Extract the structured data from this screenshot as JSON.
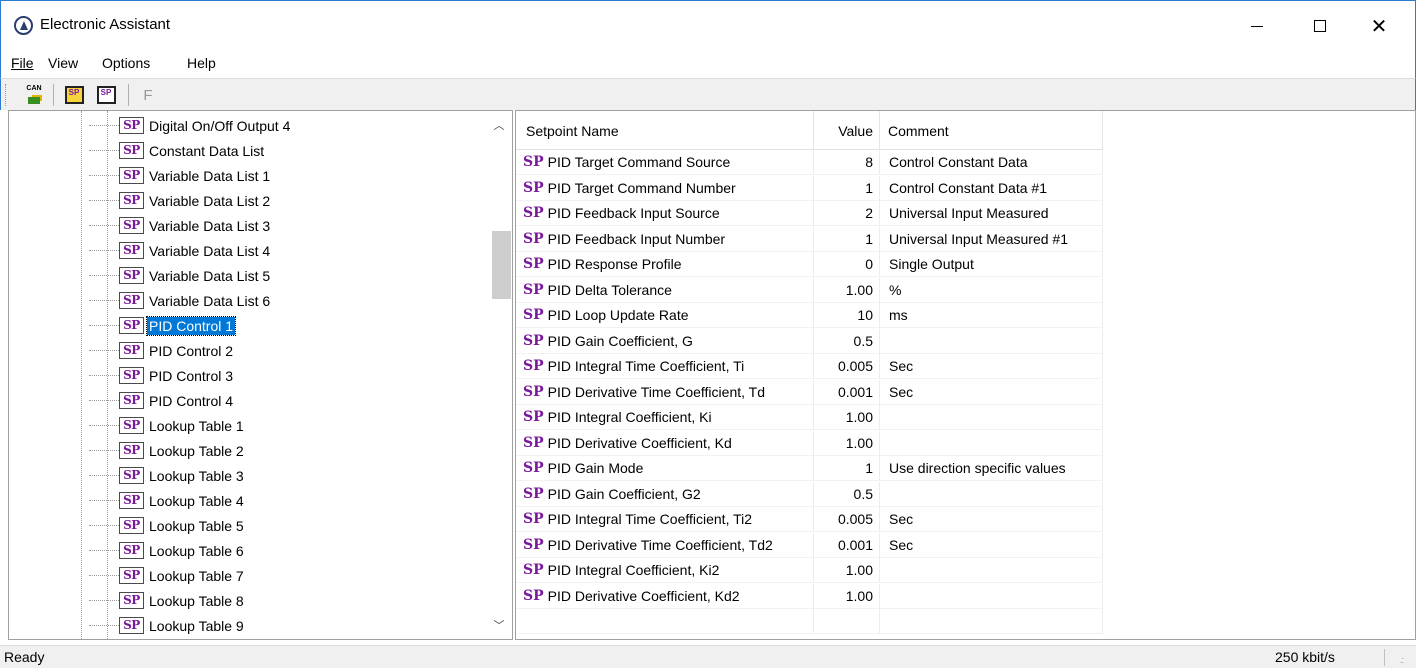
{
  "window": {
    "title": "Electronic Assistant"
  },
  "menu": {
    "file": "File",
    "view": "View",
    "options": "Options",
    "help": "Help"
  },
  "toolbar": {
    "can_icon_text": "CAN",
    "sp_open_text": "SP",
    "sp_save_text": "SP",
    "f_label": "F"
  },
  "tree": {
    "icon_text": "SP",
    "items": [
      "Digital On/Off Output 4",
      "Constant Data List",
      "Variable Data List 1",
      "Variable Data List 2",
      "Variable Data List 3",
      "Variable Data List 4",
      "Variable Data List 5",
      "Variable Data List 6",
      "PID Control 1",
      "PID Control 2",
      "PID Control 3",
      "PID Control 4",
      "Lookup Table 1",
      "Lookup Table 2",
      "Lookup Table 3",
      "Lookup Table 4",
      "Lookup Table 5",
      "Lookup Table 6",
      "Lookup Table 7",
      "Lookup Table 8",
      "Lookup Table 9"
    ],
    "selected": "PID Control 1"
  },
  "grid": {
    "columns": {
      "name": "Setpoint Name",
      "value": "Value",
      "comment": "Comment"
    },
    "sp_tag": "SP",
    "rows": [
      {
        "name": "PID Target Command Source",
        "value": "8",
        "comment": "Control Constant Data"
      },
      {
        "name": "PID Target Command Number",
        "value": "1",
        "comment": "Control Constant Data #1"
      },
      {
        "name": "PID Feedback Input Source",
        "value": "2",
        "comment": "Universal Input Measured"
      },
      {
        "name": "PID Feedback Input Number",
        "value": "1",
        "comment": "Universal Input Measured #1"
      },
      {
        "name": "PID Response Profile",
        "value": "0",
        "comment": "Single Output"
      },
      {
        "name": "PID Delta Tolerance",
        "value": "1.00",
        "comment": "%"
      },
      {
        "name": "PID Loop Update Rate",
        "value": "10",
        "comment": "ms"
      },
      {
        "name": "PID Gain Coefficient, G",
        "value": "0.5",
        "comment": ""
      },
      {
        "name": "PID Integral Time Coefficient, Ti",
        "value": "0.005",
        "comment": "Sec"
      },
      {
        "name": "PID Derivative Time Coefficient, Td",
        "value": "0.001",
        "comment": "Sec"
      },
      {
        "name": "PID Integral Coefficient, Ki",
        "value": "1.00",
        "comment": ""
      },
      {
        "name": "PID Derivative Coefficient, Kd",
        "value": "1.00",
        "comment": ""
      },
      {
        "name": "PID Gain Mode",
        "value": "1",
        "comment": "Use direction specific values"
      },
      {
        "name": "PID Gain Coefficient, G2",
        "value": "0.5",
        "comment": ""
      },
      {
        "name": "PID Integral Time Coefficient, Ti2",
        "value": "0.005",
        "comment": "Sec"
      },
      {
        "name": "PID Derivative Time Coefficient, Td2",
        "value": "0.001",
        "comment": "Sec"
      },
      {
        "name": "PID Integral Coefficient, Ki2",
        "value": "1.00",
        "comment": ""
      },
      {
        "name": "PID Derivative Coefficient, Kd2",
        "value": "1.00",
        "comment": ""
      }
    ]
  },
  "status": {
    "left": "Ready",
    "right": "250 kbit/s"
  },
  "colors": {
    "selection": "#0078d7",
    "sp_purple": "#7a1a9a",
    "window_border": "#2b7cd3"
  }
}
